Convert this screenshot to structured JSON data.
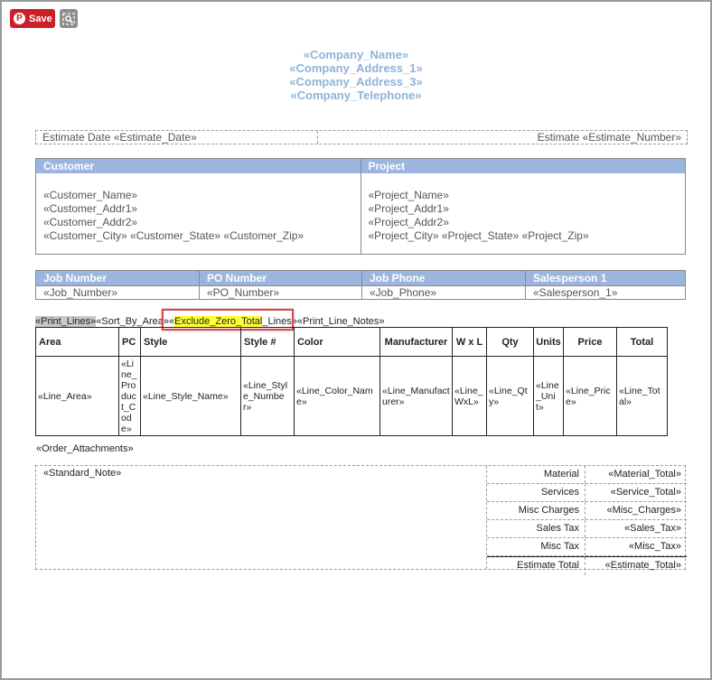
{
  "toolbar": {
    "save_label": "Save",
    "pin_glyph": "P"
  },
  "company": [
    "«Company_Name»",
    "«Company_Address_1»",
    "«Company_Address_3»",
    "«Company_Telephone»"
  ],
  "estimate": {
    "date": "Estimate Date  «Estimate_Date»",
    "number": "Estimate  «Estimate_Number»"
  },
  "customer": {
    "header": "Customer",
    "lines": [
      "«Customer_Name»",
      "«Customer_Addr1»",
      "«Customer_Addr2»",
      "«Customer_City»  «Customer_State»  «Customer_Zip»"
    ]
  },
  "project": {
    "header": "Project",
    "lines": [
      "«Project_Name»",
      "«Project_Addr1»",
      "«Project_Addr2»",
      "«Project_City»  «Project_State»  «Project_Zip»"
    ]
  },
  "job": [
    {
      "header": "Job Number",
      "value": "«Job_Number»"
    },
    {
      "header": "PO Number",
      "value": "«PO_Number»"
    },
    {
      "header": "Job Phone",
      "value": "«Job_Phone»"
    },
    {
      "header": "Salesperson 1",
      "value": "«Salesperson_1»"
    }
  ],
  "merge": {
    "a": "«Print_Lines»",
    "b": "«Sort_By_Area»",
    "c1": "«",
    "c2": "Exclude_Zero_Total",
    "c3": "_Lines»",
    "d": "«Print_Line_Notes»"
  },
  "lines_table": {
    "headers": [
      "Area",
      "PC",
      "Style",
      "Style #",
      "Color",
      "Manufacturer",
      "W x L",
      "Qty",
      "Units",
      "Price",
      "Total"
    ],
    "row": [
      "«Line_Area»",
      "«Line_Product_Code»",
      "«Line_Style_Name»",
      "«Line_Style_Number»",
      "«Line_Color_Name»",
      "«Line_Manufacturer»",
      "«Line_WxL»",
      "«Line_Qty»",
      "«Line_Unit»",
      "«Line_Price»",
      "«Line_Total»"
    ]
  },
  "attachments": "«Order_Attachments»",
  "standard_note": "«Standard_Note»",
  "totals": [
    {
      "label": "Material",
      "value": "«Material_Total»"
    },
    {
      "label": "Services",
      "value": "«Service_Total»"
    },
    {
      "label": "Misc Charges",
      "value": "«Misc_Charges»"
    },
    {
      "label": "Sales Tax",
      "value": "«Sales_Tax»"
    },
    {
      "label": "Misc Tax",
      "value": "«Misc_Tax»"
    },
    {
      "label": "Estimate Total",
      "value": "«Estimate_Total»"
    }
  ]
}
